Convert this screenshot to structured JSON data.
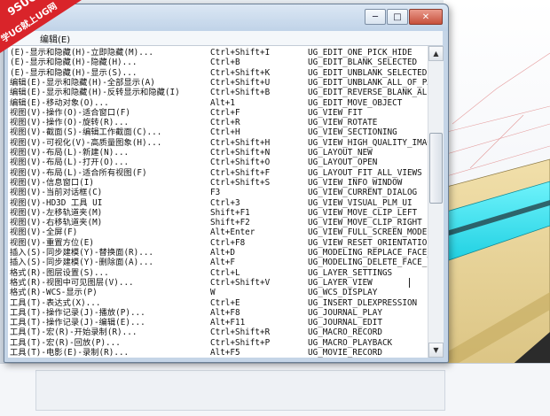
{
  "watermark": {
    "line1": "9SUG",
    "line2": "学UG就上UG网"
  },
  "window": {
    "controls": {
      "minimize": "─",
      "maximize": "□",
      "close": "✕"
    },
    "menu": "编辑(E)"
  },
  "rows": [
    [
      "(E)-显示和隐藏(H)-立即隐藏(M)...",
      "Ctrl+Shift+I",
      "UG_EDIT_ONE_PICK_HIDE"
    ],
    [
      "(E)-显示和隐藏(H)-隐藏(H)...",
      "Ctrl+B",
      "UG_EDIT_BLANK_SELECTED"
    ],
    [
      "(E)-显示和隐藏(H)-显示(S)...",
      "Ctrl+Shift+K",
      "UG_EDIT_UNBLANK_SELECTED"
    ],
    [
      "编辑(E)-显示和隐藏(H)-全部显示(A)",
      "Ctrl+Shift+U",
      "UG_EDIT_UNBLANK_ALL_OF_PART"
    ],
    [
      "编辑(E)-显示和隐藏(H)-反转显示和隐藏(I)",
      "Ctrl+Shift+B",
      "UG_EDIT_REVERSE_BLANK_ALL"
    ],
    [
      "编辑(E)-移动对象(O)...",
      "Alt+1",
      "UG_EDIT_MOVE_OBJECT"
    ],
    [
      "视图(V)-操作(O)-适合窗口(F)",
      "Ctrl+F",
      "UG_VIEW_FIT"
    ],
    [
      "视图(V)-操作(O)-旋转(R)...",
      "Ctrl+R",
      "UG_VIEW_ROTATE"
    ],
    [
      "视图(V)-截面(S)-编辑工作截面(C)...",
      "Ctrl+H",
      "UG_VIEW_SECTIONING"
    ],
    [
      "视图(V)-可视化(V)-高质量图象(H)...",
      "Ctrl+Shift+H",
      "UG_VIEW_HIGH_QUALITY_IMAGE"
    ],
    [
      "视图(V)-布局(L)-新建(N)...",
      "Ctrl+Shift+N",
      "UG_LAYOUT_NEW"
    ],
    [
      "视图(V)-布局(L)-打开(O)...",
      "Ctrl+Shift+O",
      "UG_LAYOUT_OPEN"
    ],
    [
      "视图(V)-布局(L)-适合所有视图(F)",
      "Ctrl+Shift+F",
      "UG_LAYOUT_FIT_ALL_VIEWS"
    ],
    [
      "视图(V)-信息窗口(I)",
      "Ctrl+Shift+S",
      "UG_VIEW_INFO_WINDOW"
    ],
    [
      "视图(V)-当前对话框(C)",
      "F3",
      "UG_VIEW_CURRENT_DIALOG"
    ],
    [
      "视图(V)-HD3D 工具 UI",
      "Ctrl+3",
      "UG_VIEW_VISUAL_PLM_UI"
    ],
    [
      "视图(V)-左移轨道夹(M)",
      "Shift+F1",
      "UG_VIEW_MOVE_CLIP_LEFT"
    ],
    [
      "视图(V)-右移轨道夹(M)",
      "Shift+F2",
      "UG_VIEW_MOVE_CLIP_RIGHT"
    ],
    [
      "视图(V)-全屏(F)",
      "Alt+Enter",
      "UG_VIEW_FULL_SCREEN_MODE"
    ],
    [
      "视图(V)-重置方位(E)",
      "Ctrl+F8",
      "UG_VIEW_RESET_ORIENTATION"
    ],
    [
      "插入(S)-同步建模(Y)-替换面(R)...",
      "Alt+D",
      "UG_MODELING_REPLACE_FACE_FEN"
    ],
    [
      "插入(S)-同步建模(Y)-删除面(A)...",
      "Alt+F",
      "UG_MODELING_DELETE_FACE_FEAT"
    ],
    [
      "格式(R)-图层设置(S)...",
      "Ctrl+L",
      "UG_LAYER_SETTINGS"
    ],
    [
      "格式(R)-视图中可见图层(V)...",
      "Ctrl+Shift+V",
      "UG_LAYER_VIEW"
    ],
    [
      "格式(R)-WCS-显示(P)",
      "W",
      "UG_WCS_DISPLAY"
    ],
    [
      "工具(T)-表达式(X)...",
      "Ctrl+E",
      "UG_INSERT_DLEXPRESSION"
    ],
    [
      "工具(T)-操作记录(J)-播放(P)...",
      "Alt+F8",
      "UG_JOURNAL_PLAY"
    ],
    [
      "工具(T)-操作记录(J)-编辑(E)...",
      "Alt+F11",
      "UG_JOURNAL_EDIT"
    ],
    [
      "工具(T)-宏(R)-开始录制(R)...",
      "Ctrl+Shift+R",
      "UG_MACRO_RECORD"
    ],
    [
      "工具(T)-宏(R)-回放(P)...",
      "Ctrl+Shift+P",
      "UG_MACRO_PLAYBACK"
    ],
    [
      "工具(T)-电影(E)-录制(R)...",
      "Alt+F5",
      "UG_MOVIE_RECORD"
    ]
  ],
  "scrollbar": {
    "up": "▲",
    "down": "▼"
  },
  "colors": {
    "model_gold": "#e8d39a",
    "model_cyan": "#2fe0ee",
    "model_dark": "#2b2b2b",
    "watermark_red": "#d9242a"
  }
}
